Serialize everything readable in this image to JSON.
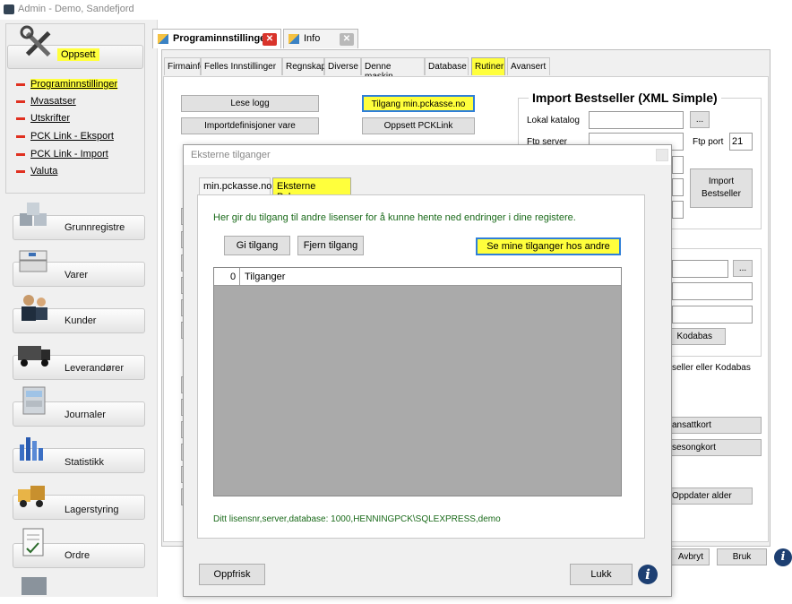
{
  "window": {
    "title": "Admin - Demo, Sandefjord"
  },
  "sidebar": {
    "group_label": "Oppsett",
    "items": [
      {
        "label": "Programinnstillinger",
        "highlighted": true
      },
      {
        "label": "Mvasatser"
      },
      {
        "label": "Utskrifter"
      },
      {
        "label": "PCK Link - Eksport"
      },
      {
        "label": "PCK Link - Import"
      },
      {
        "label": "Valuta"
      }
    ],
    "nav": [
      {
        "label": "Grunnregistre",
        "icon": "cubes-icon"
      },
      {
        "label": "Varer",
        "icon": "boxes-icon"
      },
      {
        "label": "Kunder",
        "icon": "customers-icon"
      },
      {
        "label": "Leverandører",
        "icon": "truck-icon"
      },
      {
        "label": "Journaler",
        "icon": "cabinet-icon"
      },
      {
        "label": "Statistikk",
        "icon": "stats-icon"
      },
      {
        "label": "Lagerstyring",
        "icon": "forklift-icon"
      },
      {
        "label": "Ordre",
        "icon": "order-icon"
      }
    ]
  },
  "tabs": [
    {
      "label": "Programinnstillinger",
      "active": true
    },
    {
      "label": "Info"
    }
  ],
  "subtabs": [
    "Firmainfo",
    "Felles Innstillinger",
    "Regnskap",
    "Diverse",
    "Denne maskin",
    "Database",
    "Rutiner",
    "Avansert"
  ],
  "routines": {
    "buttons_left": [
      "Lese logg",
      "Importdefinisjoner vare"
    ],
    "buttons_mid": [
      "Tilgang min.pckasse.no",
      "Oppsett PCKLink"
    ],
    "import_title": "Import Bestseller (XML Simple)",
    "lokal_katalog": "Lokal katalog",
    "ftp_server": "Ftp server",
    "ftp_port_label": "Ftp port",
    "ftp_port_value": "21",
    "import_button": "Import Bestseller",
    "browse": "...",
    "kodabas_button": "Kodabas",
    "kodabas_text": "seller eller Kodabas",
    "ansattkort": "ansattkort",
    "sesongkort": "sesongkort",
    "oppdater_alder": "Oppdater alder",
    "avbryt": "Avbryt",
    "bruk": "Bruk"
  },
  "dialog": {
    "title": "Eksterne tilganger",
    "tabs": [
      "min.pckasse.no",
      "Eksterne Pckasser"
    ],
    "info": "Her gir du tilgang til andre lisenser for å kunne hente ned endringer i dine registere.",
    "gi_tilgang": "Gi tilgang",
    "fjern_tilgang": "Fjern tilgang",
    "se_mine": "Se mine tilganger hos andre",
    "grid_header_num": "0",
    "grid_header_col": "Tilganger",
    "license_info": "Ditt lisensnr,server,database:   1000,HENNINGPCK\\SQLEXPRESS,demo",
    "oppfrisk": "Oppfrisk",
    "lukk": "Lukk",
    "info_icon": "i"
  },
  "colors": {
    "highlight": "#ffff3c",
    "accent_blue": "#2f7fd8",
    "info_green": "#1a6a1a",
    "close_red": "#d9342b"
  }
}
